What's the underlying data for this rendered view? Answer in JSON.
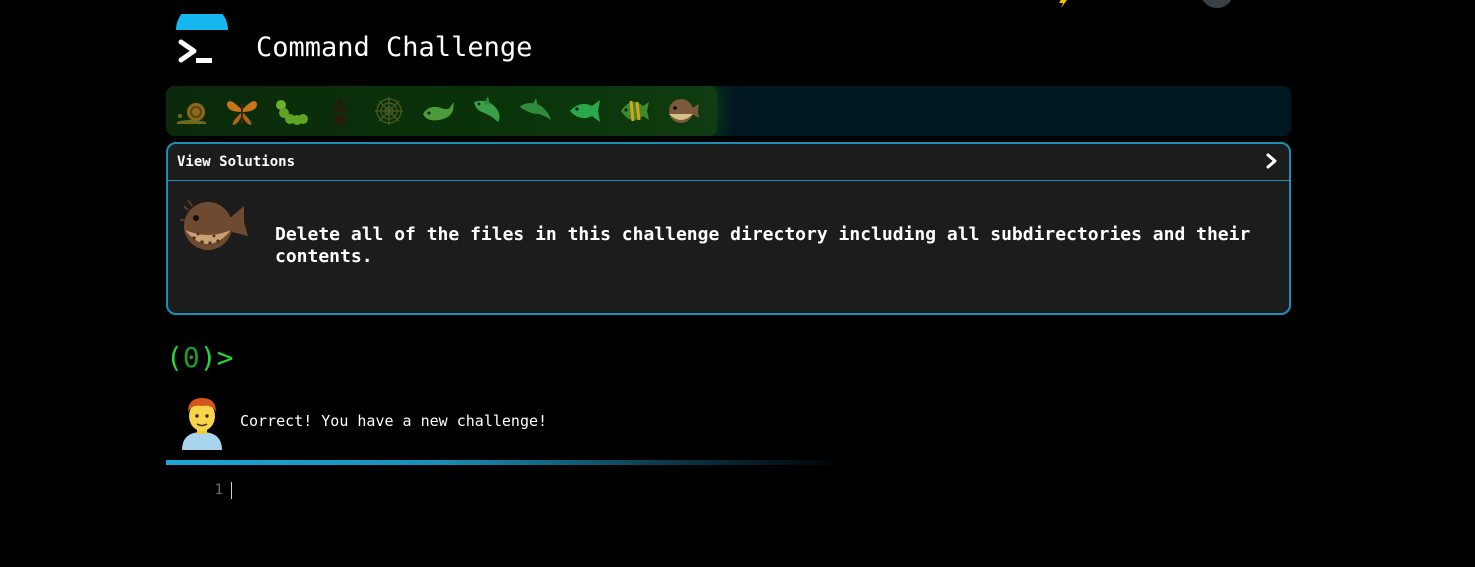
{
  "header": {
    "title": "Command Challenge"
  },
  "progress": {
    "completed_fraction": 0.49,
    "icons": [
      "snail-icon",
      "butterfly-icon",
      "caterpillar-icon",
      "ant-icon",
      "spider-web-icon",
      "whale-icon",
      "shark-icon",
      "dolphin-icon",
      "fish-icon",
      "tropical-fish-icon",
      "blowfish-icon"
    ]
  },
  "panel": {
    "header_label": "View Solutions",
    "challenge_icon": "blowfish-icon",
    "challenge_text": "Delete all of the files in this challenge directory including all subdirectories and their contents."
  },
  "prompt": {
    "open": "(",
    "count": "0",
    "close": ")>"
  },
  "message": {
    "avatar_icon": "man-avatar-icon",
    "text": "Correct! You have a new challenge!"
  },
  "editor": {
    "line_number": "1"
  },
  "colors": {
    "background": "#000000",
    "accent": "#1d8fb5",
    "prompt_green": "#27d33d",
    "progress_bg": "#001821"
  }
}
